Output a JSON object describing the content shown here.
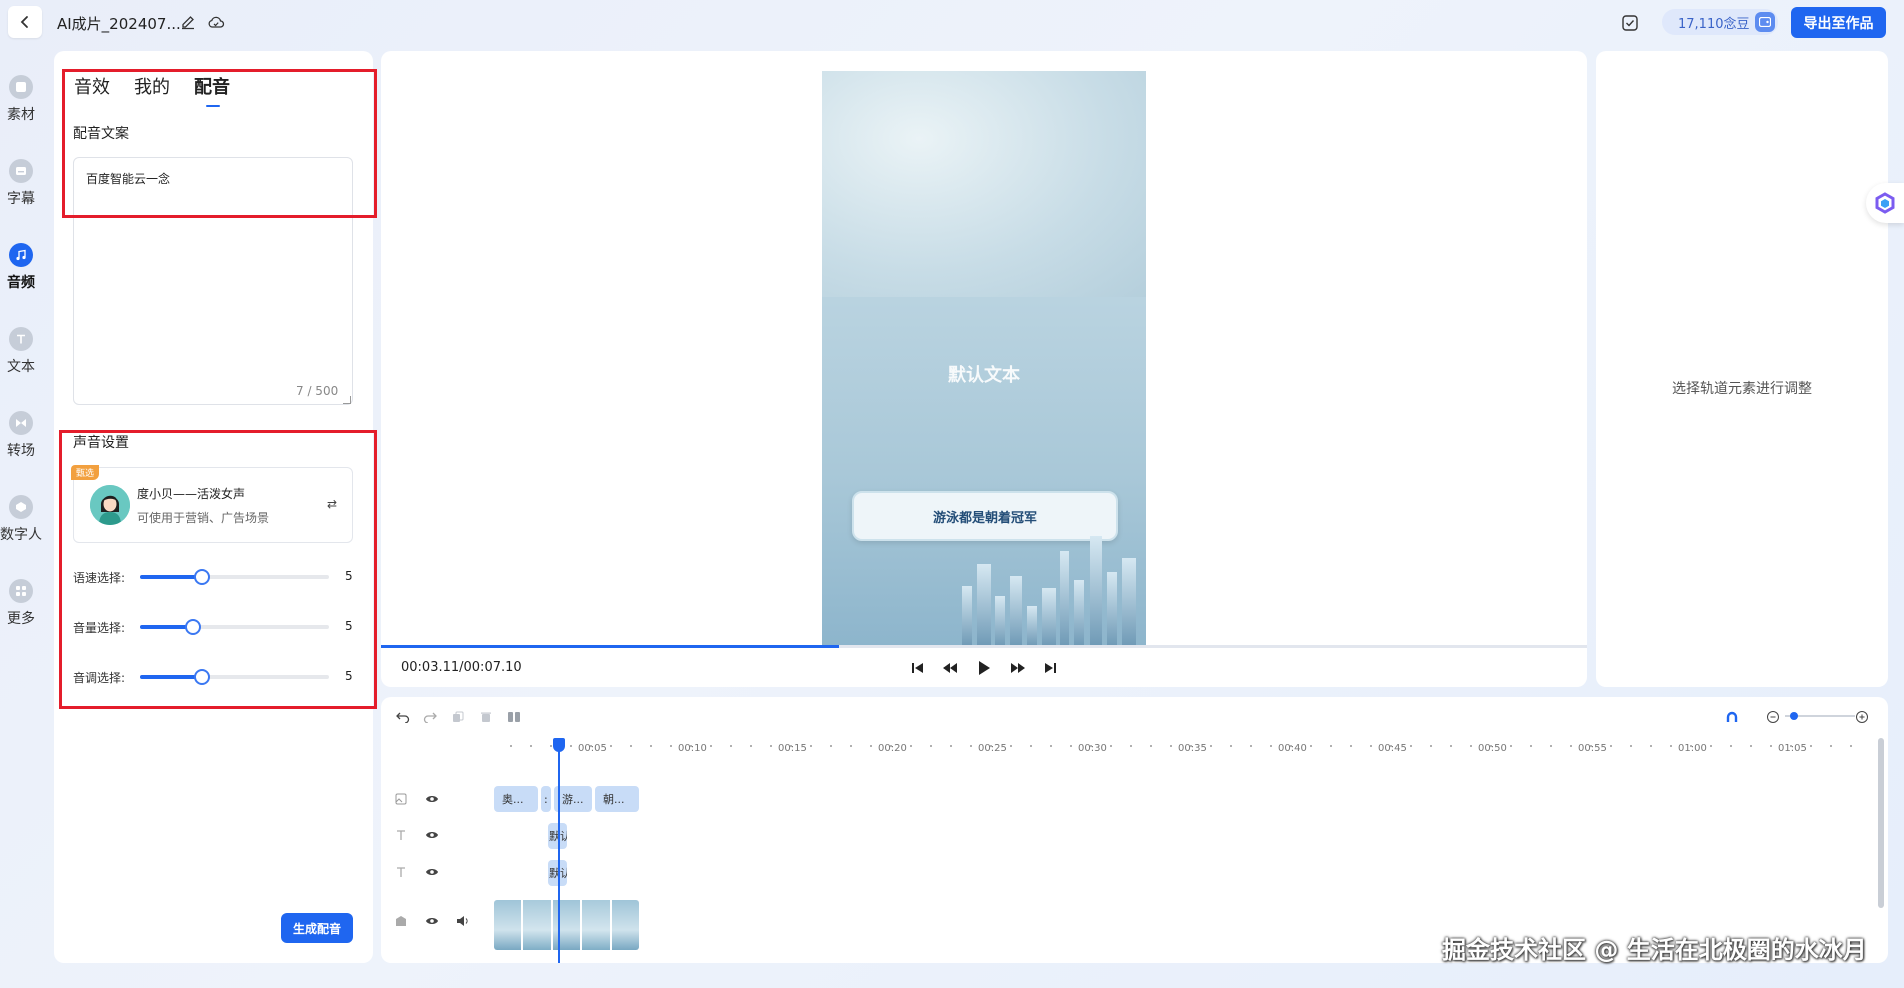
{
  "header": {
    "title": "AI成片_202407...",
    "beans": "17,110念豆",
    "export_label": "导出至作品"
  },
  "nav": {
    "items": [
      {
        "label": "素材",
        "icon": "material-icon"
      },
      {
        "label": "字幕",
        "icon": "subtitle-icon"
      },
      {
        "label": "音频",
        "icon": "music-note-icon",
        "active": true
      },
      {
        "label": "文本",
        "icon": "text-icon"
      },
      {
        "label": "转场",
        "icon": "transition-icon"
      },
      {
        "label": "数字人",
        "icon": "digital-human-icon"
      },
      {
        "label": "更多",
        "icon": "more-grid-icon"
      }
    ]
  },
  "left_panel": {
    "tabs": [
      "音效",
      "我的",
      "配音"
    ],
    "active_tab": "配音",
    "script_label": "配音文案",
    "script_text": "百度智能云一念",
    "counter": "7 / 500",
    "voice_section_label": "声音设置",
    "voice": {
      "badge": "甄选",
      "name": "度小贝——活泼女声",
      "desc": "可使用于营销、广告场景"
    },
    "sliders": [
      {
        "label": "语速选择:",
        "value": "5",
        "fraction": 0.33
      },
      {
        "label": "音量选择:",
        "value": "5",
        "fraction": 0.28
      },
      {
        "label": "音调选择:",
        "value": "5",
        "fraction": 0.33
      }
    ],
    "generate_label": "生成配音"
  },
  "preview": {
    "overlay_text": "默认文本",
    "pill_text": "游泳都是朝着冠军",
    "timecode": "00:03.11/00:07.10",
    "progress_fraction": 0.38
  },
  "right_panel": {
    "hint": "选择轨道元素进行调整"
  },
  "timeline": {
    "ruler_labels": [
      "00:05",
      "00:10",
      "00:15",
      "00:20",
      "00:25",
      "00:30",
      "00:35",
      "00:40",
      "00:45",
      "00:50",
      "00:55",
      "01:00",
      "01:05"
    ],
    "clips": {
      "image_track": [
        "奥...",
        "游...",
        "朝..."
      ],
      "text_track_1": "默认",
      "text_track_2": "默认"
    }
  },
  "watermark": "掘金技术社区 @ 生活在北极圈的水冰月",
  "colors": {
    "accent": "#1f66f0",
    "highlight_box": "#e41d2b",
    "badge": "#f2a03f"
  }
}
